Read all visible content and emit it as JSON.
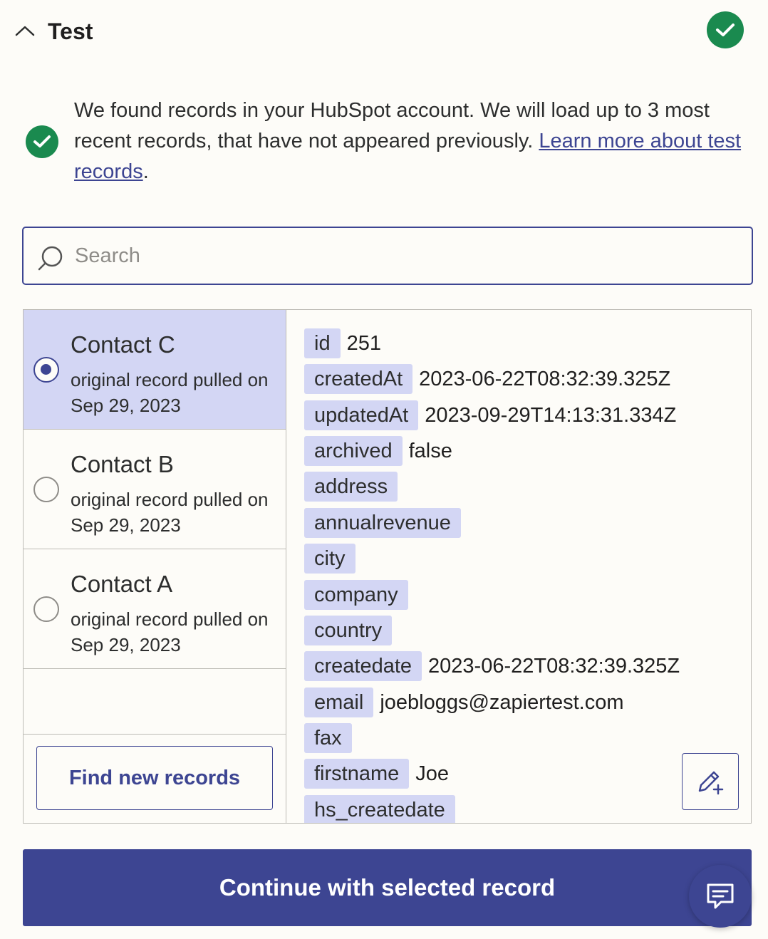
{
  "header": {
    "title": "Test",
    "status_icon": "check-circle-icon",
    "collapse_icon": "chevron-up-icon"
  },
  "info": {
    "text": "We found records in your HubSpot account. We will load up to 3 most recent records, that have not appeared previously. ",
    "link_text": "Learn more about test records",
    "trailing": "."
  },
  "search": {
    "placeholder": "Search",
    "value": ""
  },
  "records": [
    {
      "name": "Contact C",
      "subtitle": "original record pulled on Sep 29, 2023",
      "selected": true
    },
    {
      "name": "Contact B",
      "subtitle": "original record pulled on Sep 29, 2023",
      "selected": false
    },
    {
      "name": "Contact A",
      "subtitle": "original record pulled on Sep 29, 2023",
      "selected": false
    }
  ],
  "find_button": "Find new records",
  "fields": [
    {
      "key": "id",
      "value": "251"
    },
    {
      "key": "createdAt",
      "value": "2023-06-22T08:32:39.325Z"
    },
    {
      "key": "updatedAt",
      "value": "2023-09-29T14:13:31.334Z"
    },
    {
      "key": "archived",
      "value": "false"
    },
    {
      "key": "address",
      "value": ""
    },
    {
      "key": "annualrevenue",
      "value": ""
    },
    {
      "key": "city",
      "value": ""
    },
    {
      "key": "company",
      "value": ""
    },
    {
      "key": "country",
      "value": ""
    },
    {
      "key": "createdate",
      "value": "2023-06-22T08:32:39.325Z"
    },
    {
      "key": "email",
      "value": "joebloggs@zapiertest.com"
    },
    {
      "key": "fax",
      "value": ""
    },
    {
      "key": "firstname",
      "value": "Joe"
    },
    {
      "key": "hs_createdate",
      "value": ""
    }
  ],
  "continue_button": "Continue with selected record",
  "colors": {
    "accent": "#3d4592",
    "success": "#1a8a4f",
    "selected_bg": "#d3d6f4",
    "background": "#fdfcf8"
  }
}
